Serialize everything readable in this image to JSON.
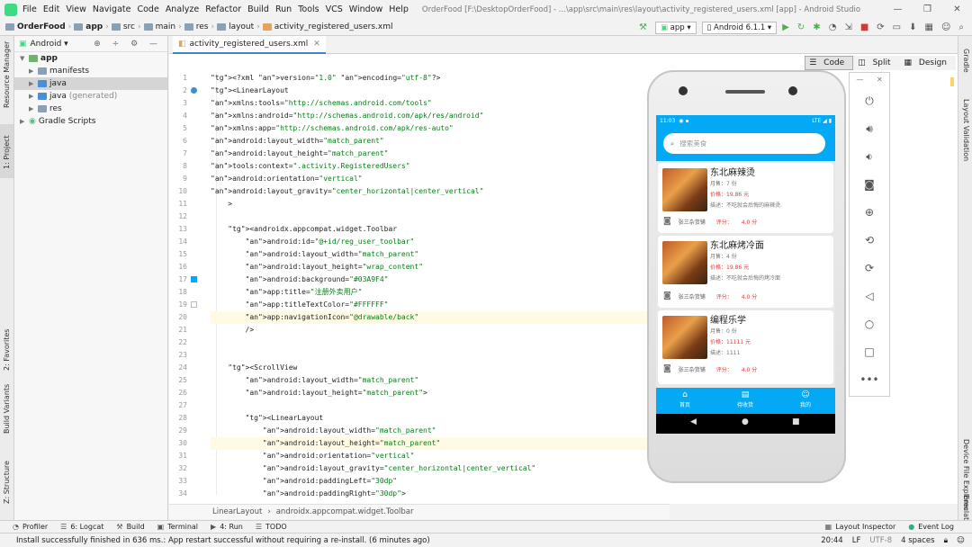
{
  "menubar": {
    "items": [
      "File",
      "Edit",
      "View",
      "Navigate",
      "Code",
      "Analyze",
      "Refactor",
      "Build",
      "Run",
      "Tools",
      "VCS",
      "Window",
      "Help"
    ],
    "title": "OrderFood [F:\\DesktopOrderFood] - ...\\app\\src\\main\\res\\layout\\activity_registered_users.xml [app] - Android Studio"
  },
  "navbar": {
    "crumbs": [
      "OrderFood",
      "app",
      "src",
      "main",
      "res",
      "layout",
      "activity_registered_users.xml"
    ],
    "run_config": "app",
    "device": "Android 6.1.1"
  },
  "left_strip": {
    "resource_manager": "Resource Manager",
    "project": "1: Project",
    "favorites": "2: Favorites",
    "build_variants": "Build Variants",
    "structure": "Z: Structure"
  },
  "right_strip": {
    "gradle": "Gradle",
    "layout_validation": "Layout Validation",
    "device_file_explorer": "Device File Explorer",
    "emulator": "Emulator"
  },
  "project_panel": {
    "view_mode": "Android",
    "tree": [
      {
        "label": "app",
        "level": 0,
        "bold": true
      },
      {
        "label": "manifests",
        "level": 1
      },
      {
        "label": "java",
        "level": 1,
        "selected": true
      },
      {
        "label": "java",
        "extra": "(generated)",
        "level": 1
      },
      {
        "label": "res",
        "level": 1
      },
      {
        "label": "Gradle Scripts",
        "level": 0
      }
    ]
  },
  "editor": {
    "tab_label": "activity_registered_users.xml",
    "modes": [
      "Code",
      "Split",
      "Design"
    ],
    "lines": [
      {
        "n": 1,
        "text": "<?xml version=\"1.0\" encoding=\"utf-8\"?>"
      },
      {
        "n": 2,
        "text": "<LinearLayout"
      },
      {
        "n": 3,
        "text": "xmlns:tools=\"http://schemas.android.com/tools\""
      },
      {
        "n": 4,
        "text": "xmlns:android=\"http://schemas.android.com/apk/res/android\""
      },
      {
        "n": 5,
        "text": "xmlns:app=\"http://schemas.android.com/apk/res-auto\""
      },
      {
        "n": 6,
        "text": "android:layout_width=\"match_parent\""
      },
      {
        "n": 7,
        "text": "android:layout_height=\"match_parent\""
      },
      {
        "n": 8,
        "text": "tools:context=\".activity.RegisteredUsers\""
      },
      {
        "n": 9,
        "text": "android:orientation=\"vertical\""
      },
      {
        "n": 10,
        "text": "android:layout_gravity=\"center_horizontal|center_vertical\""
      },
      {
        "n": 11,
        "text": "    >"
      },
      {
        "n": 12,
        "text": ""
      },
      {
        "n": 13,
        "text": "    <androidx.appcompat.widget.Toolbar"
      },
      {
        "n": 14,
        "text": "        android:id=\"@+id/reg_user_toolbar\""
      },
      {
        "n": 15,
        "text": "        android:layout_width=\"match_parent\""
      },
      {
        "n": 16,
        "text": "        android:layout_height=\"wrap_content\""
      },
      {
        "n": 17,
        "text": "        android:background=\"#03A9F4\""
      },
      {
        "n": 18,
        "text": "        app:title=\"注册外卖用户\""
      },
      {
        "n": 19,
        "text": "        app:titleTextColor=\"#FFFFFF\""
      },
      {
        "n": 20,
        "text": "        app:navigationIcon=\"@drawable/back\""
      },
      {
        "n": 21,
        "text": "        />"
      },
      {
        "n": 22,
        "text": ""
      },
      {
        "n": 23,
        "text": ""
      },
      {
        "n": 24,
        "text": "    <ScrollView"
      },
      {
        "n": 25,
        "text": "        android:layout_width=\"match_parent\""
      },
      {
        "n": 26,
        "text": "        android:layout_height=\"match_parent\">"
      },
      {
        "n": 27,
        "text": ""
      },
      {
        "n": 28,
        "text": "        <LinearLayout"
      },
      {
        "n": 29,
        "text": "            android:layout_width=\"match_parent\""
      },
      {
        "n": 30,
        "text": "            android:layout_height=\"match_parent\""
      },
      {
        "n": 31,
        "text": "            android:orientation=\"vertical\""
      },
      {
        "n": 32,
        "text": "            android:layout_gravity=\"center_horizontal|center_vertical\""
      },
      {
        "n": 33,
        "text": "            android:paddingLeft=\"30dp\""
      },
      {
        "n": 34,
        "text": "            android:paddingRight=\"30dp\">"
      }
    ],
    "breadcrumb": [
      "LinearLayout",
      "androidx.appcompat.widget.Toolbar"
    ]
  },
  "phone": {
    "status_time": "11:03",
    "status_right": "LTE ◢ ▮",
    "search_placeholder": "搜索美食",
    "cards": [
      {
        "name": "东北麻辣烫",
        "sales": "月售：7 份",
        "price": "价格：19.86 元",
        "desc": "描述：不吃就会后悔的麻辣烫.",
        "shop": "张三杂货铺",
        "score_label": "评分：",
        "score": "4.0 分"
      },
      {
        "name": "东北麻烤冷面",
        "sales": "月售：4 份",
        "price": "价格：19.86 元",
        "desc": "描述：不吃就会后悔的烤冷面",
        "shop": "张三杂货铺",
        "score_label": "评分：",
        "score": "4.0 分"
      },
      {
        "name": "编程乐学",
        "sales": "月售：0 份",
        "price": "价格：11111 元",
        "desc": "描述：1111",
        "shop": "张三杂货铺",
        "score_label": "评分：",
        "score": "4.0 分"
      }
    ],
    "tabs": [
      "首页",
      "待收货",
      "我的"
    ]
  },
  "bottom_tabs": {
    "left": [
      "Profiler",
      "6: Logcat",
      "Build",
      "Terminal",
      "4: Run",
      "TODO"
    ],
    "right": [
      "Layout Inspector",
      "Event Log"
    ]
  },
  "status": {
    "message": "Install successfully finished in 636 ms.: App restart successful without requiring a re-install. (6 minutes ago)",
    "position": "20:44",
    "line_sep": "LF",
    "encoding": "UTF-8",
    "indent": "4 spaces"
  }
}
